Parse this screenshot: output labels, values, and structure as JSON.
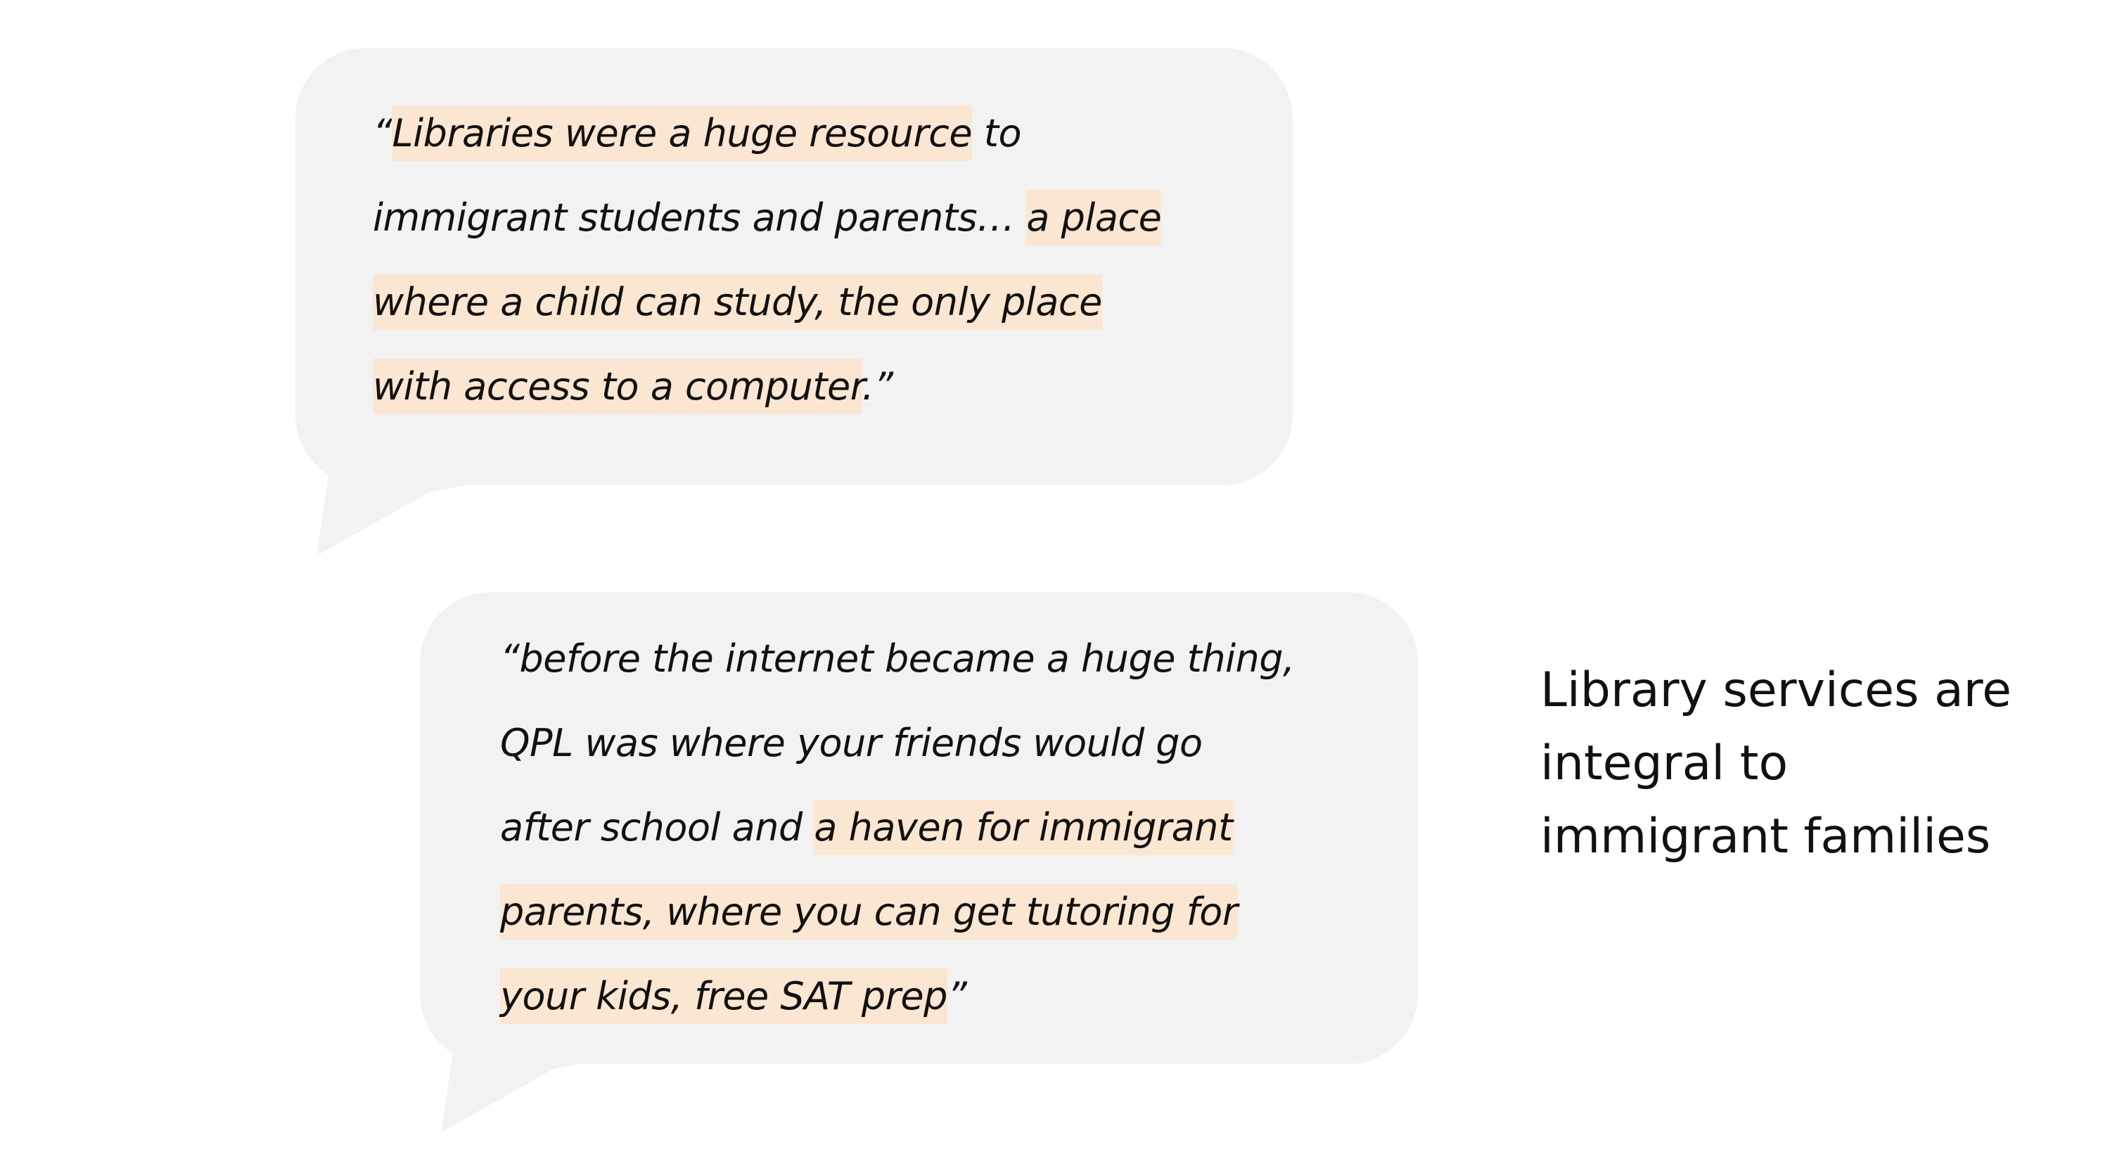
{
  "quotes": [
    {
      "lines": [
        [
          {
            "text": "“",
            "highlight": false
          },
          {
            "text": "Libraries were a huge resource",
            "highlight": true
          },
          {
            "text": " to",
            "highlight": false
          }
        ],
        [
          {
            "text": "immigrant students and parents… ",
            "highlight": false
          },
          {
            "text": "a place",
            "highlight": true
          }
        ],
        [
          {
            "text": "where a child can study, the only place",
            "highlight": true
          }
        ],
        [
          {
            "text": "with access to a computer",
            "highlight": true
          },
          {
            "text": ".”",
            "highlight": false
          }
        ]
      ]
    },
    {
      "lines": [
        [
          {
            "text": "“before the internet became a huge thing,",
            "highlight": false
          }
        ],
        [
          {
            "text": "QPL was where your friends would go",
            "highlight": false
          }
        ],
        [
          {
            "text": "after school and ",
            "highlight": false
          },
          {
            "text": "a haven for immigrant",
            "highlight": true
          }
        ],
        [
          {
            "text": "parents, where you can get tutoring for",
            "highlight": true
          }
        ],
        [
          {
            "text": "your kids, free SAT prep",
            "highlight": true
          },
          {
            "text": "”",
            "highlight": false
          }
        ]
      ]
    }
  ],
  "caption": {
    "lines": [
      "Library services are",
      "integral to",
      "immigrant families"
    ]
  },
  "colors": {
    "bubble": "#f2f2f2",
    "highlight": "#fbe6d2",
    "text": "#111111"
  }
}
